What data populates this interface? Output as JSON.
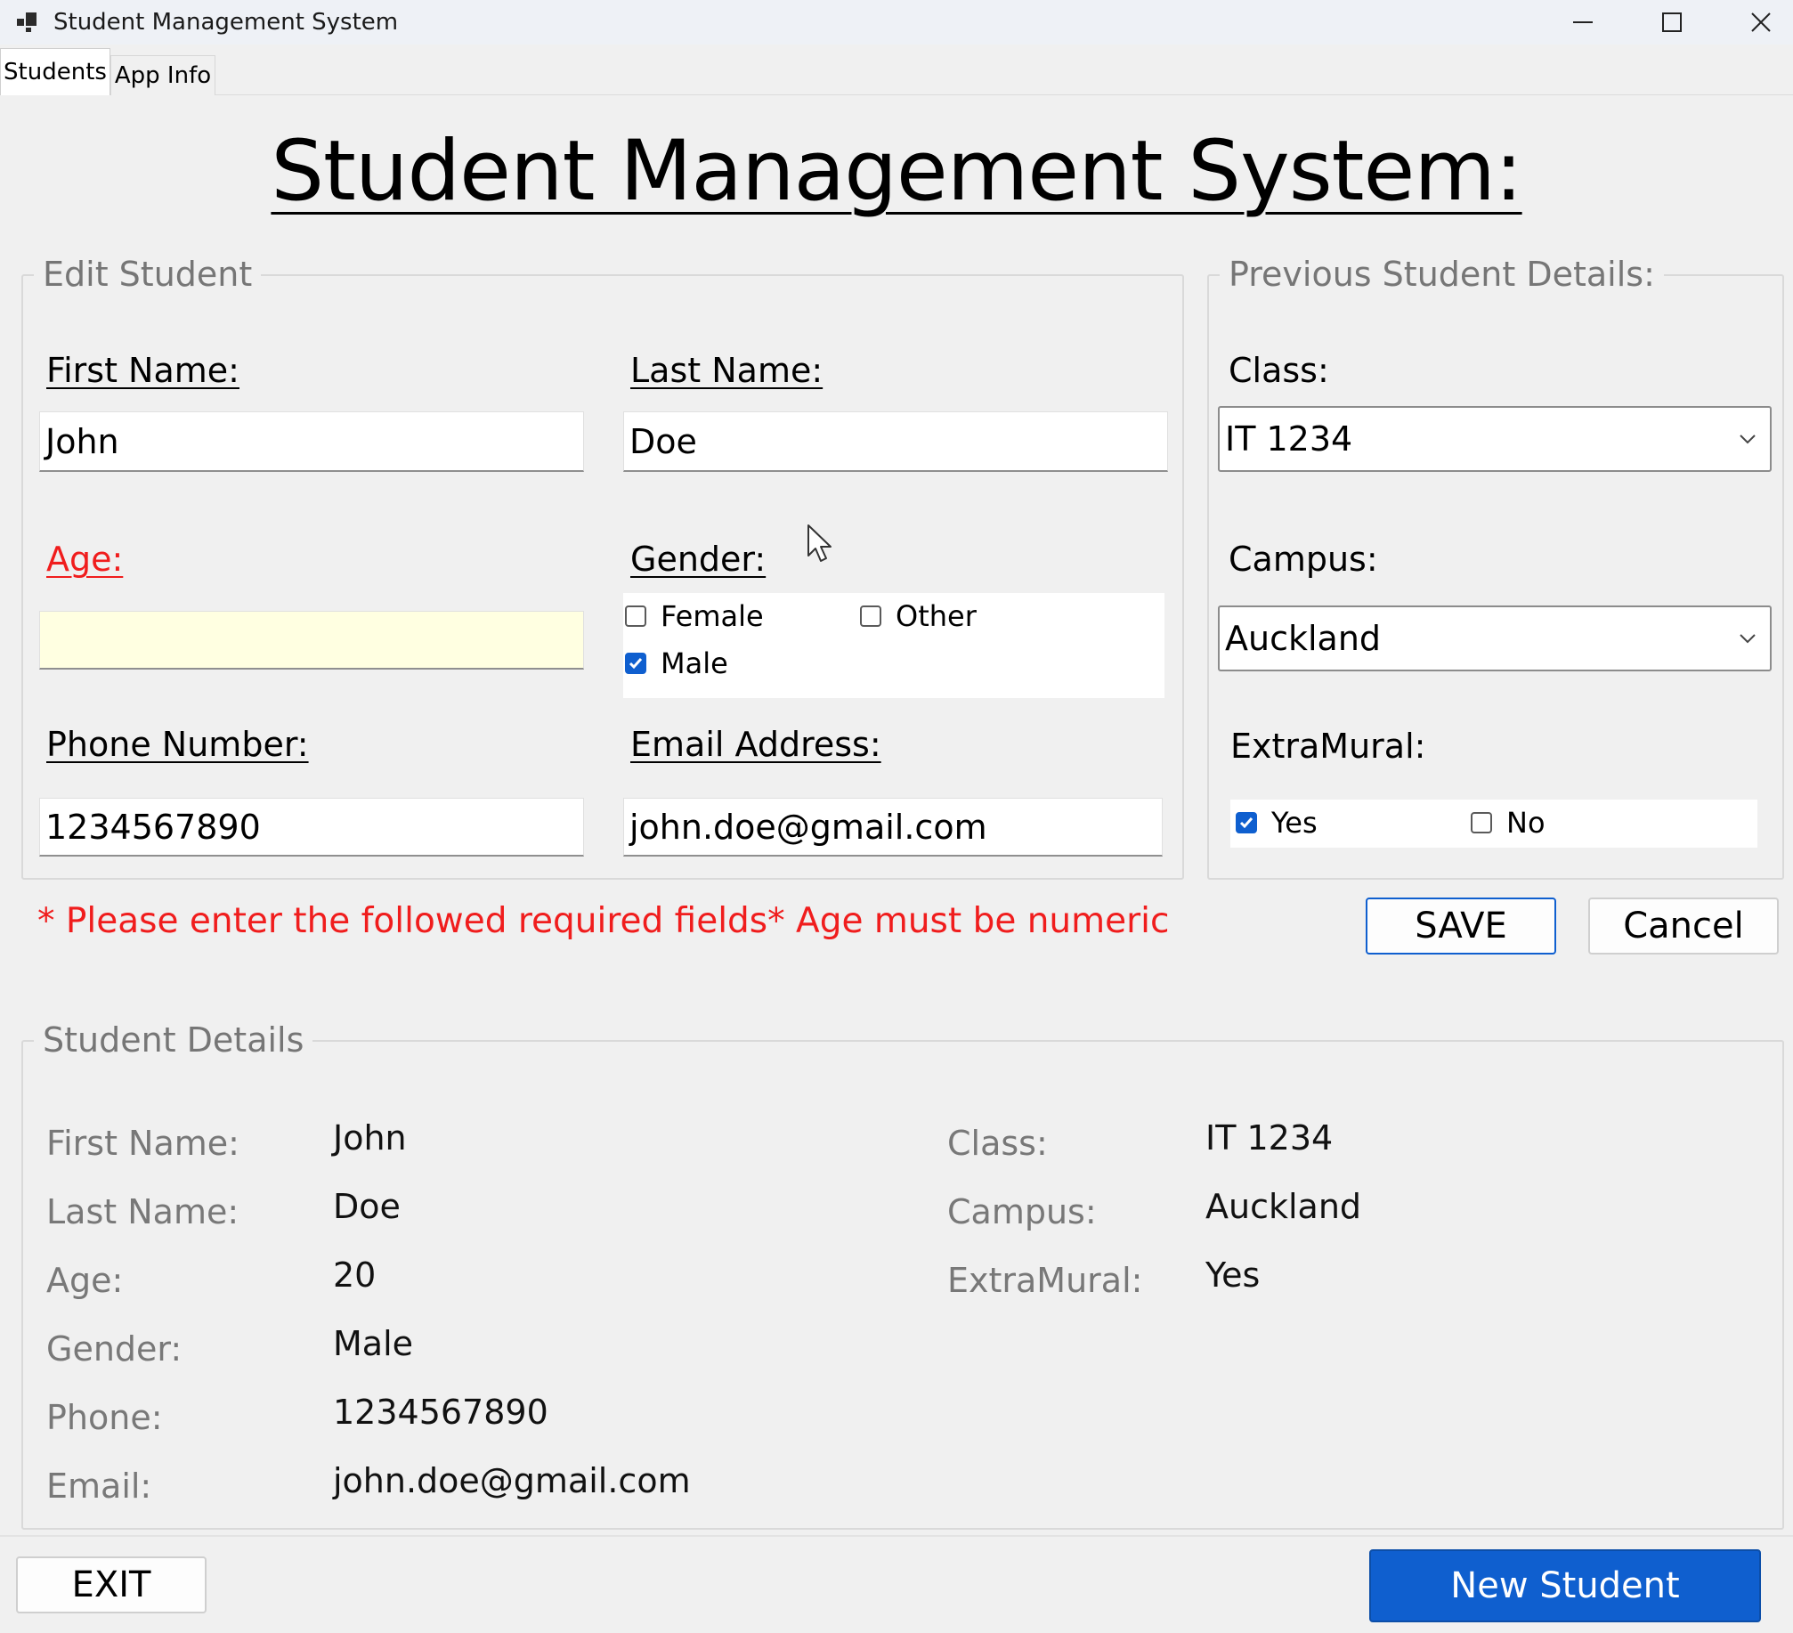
{
  "window": {
    "title": "Student Management System",
    "controls": {
      "minimize": "minimize-icon",
      "maximize": "maximize-icon",
      "close": "close-icon"
    }
  },
  "tabs": [
    {
      "label": "Students",
      "active": true
    },
    {
      "label": "App Info",
      "active": false
    }
  ],
  "page_title": "Student Management System:",
  "edit": {
    "legend": "Edit Student",
    "first_name": {
      "label": "First Name:",
      "value": "John"
    },
    "last_name": {
      "label": "Last Name:",
      "value": "Doe"
    },
    "age": {
      "label": "Age:",
      "value": ""
    },
    "gender": {
      "label": "Gender:",
      "options": [
        {
          "label": "Female",
          "checked": false
        },
        {
          "label": "Other",
          "checked": false
        },
        {
          "label": "Male",
          "checked": true
        }
      ]
    },
    "phone": {
      "label": "Phone Number:",
      "value": "1234567890"
    },
    "email": {
      "label": "Email Address:",
      "value": "john.doe@gmail.com"
    }
  },
  "previous": {
    "legend": "Previous Student Details:",
    "class": {
      "label": "Class:",
      "selected": "IT 1234"
    },
    "campus": {
      "label": "Campus:",
      "selected": "Auckland"
    },
    "extramural": {
      "label": "ExtraMural:",
      "options": [
        {
          "label": "Yes",
          "checked": true
        },
        {
          "label": "No",
          "checked": false
        }
      ]
    }
  },
  "error_message": "* Please enter the followed required fields* Age must be numeric",
  "buttons": {
    "save": "SAVE",
    "cancel": "Cancel",
    "exit": "EXIT",
    "new_student": "New Student"
  },
  "details": {
    "legend": "Student Details",
    "left": [
      {
        "label": "First Name:",
        "value": "John"
      },
      {
        "label": "Last Name:",
        "value": "Doe"
      },
      {
        "label": "Age:",
        "value": "20"
      },
      {
        "label": "Gender:",
        "value": "Male"
      },
      {
        "label": "Phone:",
        "value": "1234567890"
      },
      {
        "label": "Email:",
        "value": "john.doe@gmail.com"
      }
    ],
    "right": [
      {
        "label": "Class:",
        "value": "IT 1234"
      },
      {
        "label": "Campus:",
        "value": "Auckland"
      },
      {
        "label": "ExtraMural:",
        "value": "Yes"
      }
    ]
  },
  "colors": {
    "accent": "#0f5fcf",
    "error": "#f01d1d",
    "warning_field": "#ffffe1"
  }
}
